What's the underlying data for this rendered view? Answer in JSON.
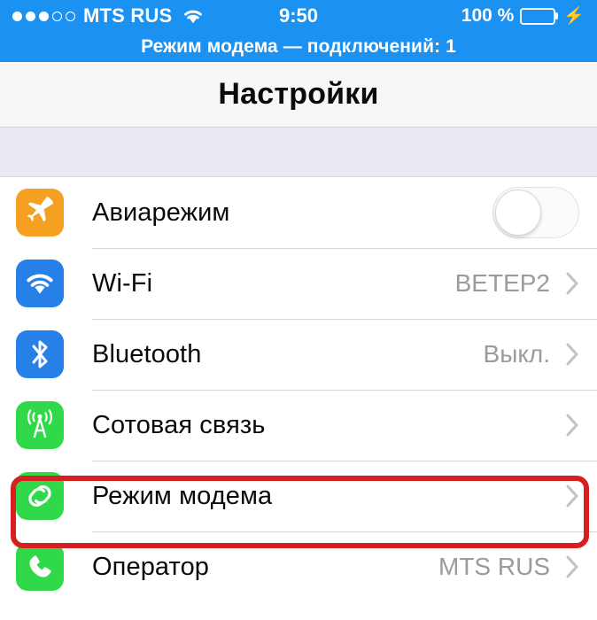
{
  "status_bar": {
    "carrier": "MTS RUS",
    "signal_filled": 3,
    "signal_empty": 2,
    "wifi_icon": "wifi-icon",
    "time": "9:50",
    "battery_percent": "100 %",
    "battery_level": 100,
    "charging_icon": "lightning-bolt-icon"
  },
  "tether_banner": {
    "text": "Режим модема — подключений: 1",
    "background": "#1b92f2"
  },
  "nav": {
    "title": "Настройки"
  },
  "settings": {
    "rows": [
      {
        "id": "airplane-mode",
        "label": "Авиарежим",
        "icon": "airplane-icon",
        "icon_color": "#f5a021",
        "control": "toggle",
        "toggle_on": false,
        "value": "",
        "chevron": false
      },
      {
        "id": "wifi",
        "label": "Wi-Fi",
        "icon": "wifi-icon",
        "icon_color": "#2680e8",
        "control": "disclosure",
        "value": "ВЕТЕР2",
        "chevron": true
      },
      {
        "id": "bluetooth",
        "label": "Bluetooth",
        "icon": "bluetooth-icon",
        "icon_color": "#2680e8",
        "control": "disclosure",
        "value": "Выкл.",
        "chevron": true
      },
      {
        "id": "cellular",
        "label": "Сотовая связь",
        "icon": "cell-tower-icon",
        "icon_color": "#30d94a",
        "control": "disclosure",
        "value": "",
        "chevron": true
      },
      {
        "id": "personal-hotspot",
        "label": "Режим модема",
        "icon": "hotspot-links-icon",
        "icon_color": "#30d94a",
        "control": "disclosure",
        "value": "",
        "chevron": true,
        "highlighted": true
      },
      {
        "id": "carrier",
        "label": "Оператор",
        "icon": "phone-handset-icon",
        "icon_color": "#30d94a",
        "control": "disclosure",
        "value": "MTS RUS",
        "chevron": true
      }
    ]
  },
  "annotation": {
    "highlight_color": "#d81f1f",
    "target_row": "personal-hotspot"
  }
}
